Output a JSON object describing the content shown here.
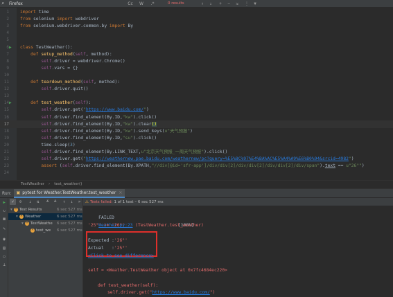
{
  "findbar": {
    "query": "Firefox",
    "results": "0 results",
    "options": [
      "Cc",
      "W",
      ".*"
    ]
  },
  "editor": {
    "lines": [
      {
        "n": "1",
        "html": "<span class=\"kw\">import</span> time"
      },
      {
        "n": "2",
        "html": "<span class=\"kw\">from</span> selenium <span class=\"kw\">import</span> webdriver"
      },
      {
        "n": "3",
        "html": "<span class=\"kw\">from</span> selenium.webdriver.common.by <span class=\"kw\">import</span> By"
      },
      {
        "n": "4",
        "html": ""
      },
      {
        "n": "5",
        "html": ""
      },
      {
        "n": "6",
        "html": "<span class=\"kw\">class</span> TestWeather():",
        "run": true
      },
      {
        "n": "7",
        "html": "    <span class=\"kw\">def</span> <span class=\"fn\">setup_method</span>(<span class=\"self\">self</span>, method):"
      },
      {
        "n": "8",
        "html": "        <span class=\"self\">self</span>.driver = webdriver.Chrome()"
      },
      {
        "n": "9",
        "html": "        <span class=\"self\">self</span>.vars = {}"
      },
      {
        "n": "10",
        "html": ""
      },
      {
        "n": "11",
        "html": "    <span class=\"kw\">def</span> <span class=\"fn\">teardown_method</span>(<span class=\"self\">self</span>, method):"
      },
      {
        "n": "12",
        "html": "        <span class=\"self\">self</span>.driver.quit()"
      },
      {
        "n": "13",
        "html": ""
      },
      {
        "n": "14",
        "html": "    <span class=\"kw\">def</span> <span class=\"fn\">test_weather</span>(<span class=\"self\">self</span>):",
        "run": true
      },
      {
        "n": "15",
        "html": "        <span class=\"self\">self</span>.driver.get(<span class=\"str\">\"<span class=\"url\">https://www.baidu.com/</span>\"</span>)"
      },
      {
        "n": "16",
        "html": "        <span class=\"self\">self</span>.driver.find_element(By.ID,<span class=\"str\">\"kw\"</span>).click()"
      },
      {
        "n": "17",
        "html": "        <span class=\"self\">self</span>.driver.find_element(By.ID,<span class=\"str\">\"kw\"</span>).clear<span class=\"hl\">()</span>",
        "current": true
      },
      {
        "n": "18",
        "html": "        <span class=\"self\">self</span>.driver.find_element(By.ID,<span class=\"str\">\"kw\"</span>).send_keys(<span class=\"str\">u\"天气预报\"</span>)"
      },
      {
        "n": "19",
        "html": "        <span class=\"self\">self</span>.driver.find_element(By.ID,<span class=\"str\">\"su\"</span>).click()"
      },
      {
        "n": "20",
        "html": "        time.sleep(<span class=\"num\">3</span>)"
      },
      {
        "n": "21",
        "html": "        <span class=\"self\">self</span>.driver.find_element(By.LINK_TEXT,<span class=\"str\">u\"北京天气预报_一周天气预报\"</span>).click()"
      },
      {
        "n": "22",
        "html": "        <span class=\"self\">self</span>.driver.get(<span class=\"str\">\"<span class=\"url\">https://weathernew.pae.baidu.com/weathernew/pc?query=%E5%8C%97%E4%BA%AC%E5%A4%A9%E6%B0%94&srcid=4982</span>\"</span>)"
      },
      {
        "n": "23",
        "html": "        <span class=\"kw\">assert</span> (<span class=\"self\">self</span>.driver.find_element(By.XPATH,<span class=\"str\">\"//div[@id='sfr-app']/div/div[2]/div/div[2]/div/div[2]/div/span\"</span>).<u>text</u> == <span class=\"str\">u\"26°\"</span>)"
      },
      {
        "n": "24",
        "html": ""
      }
    ]
  },
  "breadcrumb": {
    "class_name": "TestWeather",
    "method_name": "test_weather()"
  },
  "runbar": {
    "label": "Run:",
    "tab": "pytest for Weather.TestWeather.test_weather"
  },
  "status": {
    "failed_text": "Tests failed:",
    "count_text": "1 of 1 test – 6 sec 527 ms"
  },
  "tree": {
    "nodes": [
      {
        "name": "Test Results",
        "time": "6 sec 527 ms",
        "indent": 0,
        "arrow": "▾"
      },
      {
        "name": "Weather",
        "time": "6 sec 527 ms",
        "indent": 1,
        "arrow": "▾",
        "selected": true
      },
      {
        "name": "TestWeathe",
        "time": "6 sec 527 ms",
        "indent": 2,
        "arrow": "▾"
      },
      {
        "name": "test_we",
        "time": "6 sec 527 ms",
        "indent": 3,
        "arrow": ""
      }
    ]
  },
  "output": {
    "failed": "FAILED",
    "percent": "[100%]",
    "loc_link": "Weather.py:23",
    "loc_rest": " (TestWeather.test_weather)",
    "neq": "'25°' != '26°'",
    "expected_label": "Expected :",
    "expected_value": "'26°'",
    "actual_label": "Actual   :",
    "actual_value": "'25°'",
    "diff_link": "<Click to see difference>",
    "self_line": "self = <Weather.TestWeather object at 0x7fc4684ec220>",
    "def_line_kw": "def",
    "def_line_rest": " test_weather(self):",
    "get_line_pre": "self.driver.get(\"",
    "get_line_url": "https://www.baidu.com/",
    "get_line_post": "\")"
  }
}
